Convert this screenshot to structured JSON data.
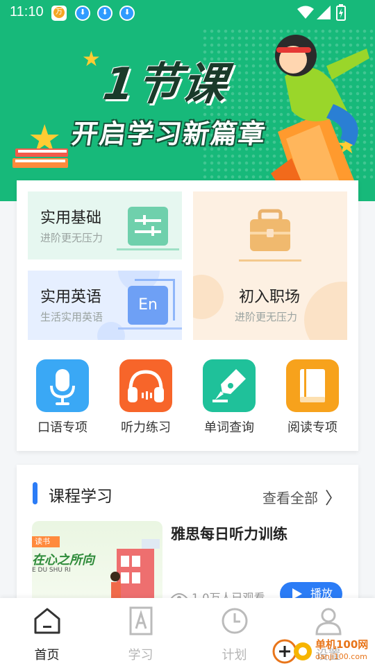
{
  "status_bar": {
    "time": "11:10",
    "icons": [
      "wanyi-app-icon",
      "download-icon",
      "download-icon",
      "download-icon",
      "wifi-icon",
      "signal-icon",
      "battery-icon"
    ]
  },
  "banner": {
    "title": "1节课",
    "subtitle": "开启学习新篇章"
  },
  "categories": {
    "basics": {
      "title": "实用基础",
      "subtitle": "进阶更无压力"
    },
    "english": {
      "title": "实用英语",
      "subtitle": "生活实用英语",
      "badge": "En"
    },
    "workplace": {
      "title": "初入职场",
      "subtitle": "进阶更无压力"
    }
  },
  "shortcuts": [
    {
      "label": "口语专项",
      "icon": "microphone-icon",
      "color": "#3aa8f5"
    },
    {
      "label": "听力练习",
      "icon": "headphones-icon",
      "color": "#f7652a"
    },
    {
      "label": "单词查询",
      "icon": "pen-nib-icon",
      "color": "#1fc19a"
    },
    {
      "label": "阅读专项",
      "icon": "book-icon",
      "color": "#f7a21c"
    }
  ],
  "course_section": {
    "title": "课程学习",
    "see_all": "查看全部",
    "thumb_text": "在心之所向",
    "thumb_tag": "读书",
    "thumb_pinyin": "E DU SHU RI",
    "course": {
      "name": "雅思每日听力训练",
      "views": "1.0万人已观看",
      "play": "播放"
    }
  },
  "bottom_nav": [
    {
      "label": "首页",
      "icon": "home-icon",
      "active": true
    },
    {
      "label": "学习",
      "icon": "study-book-icon",
      "active": false
    },
    {
      "label": "计划",
      "icon": "clock-icon",
      "active": false
    },
    {
      "label": "设置",
      "icon": "user-icon",
      "active": false
    }
  ],
  "watermark": {
    "name": "单机100网",
    "url": "danji100.com"
  },
  "colors": {
    "brand_green": "#17b97a",
    "accent_blue": "#2b7cf6"
  }
}
